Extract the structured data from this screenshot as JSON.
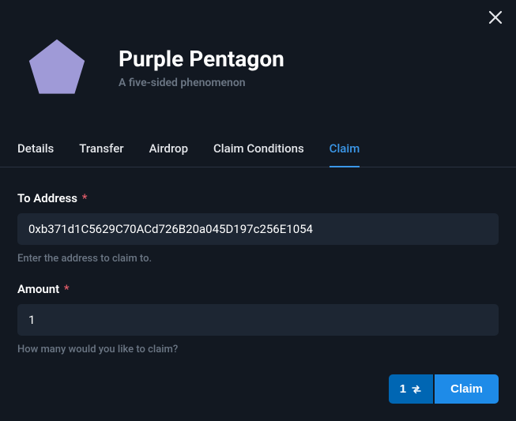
{
  "header": {
    "title": "Purple Pentagon",
    "subtitle": "A five-sided phenomenon",
    "pentagon_fill": "#9f9ad7"
  },
  "tabs": {
    "items": [
      "Details",
      "Transfer",
      "Airdrop",
      "Claim Conditions",
      "Claim"
    ],
    "active_index": 4
  },
  "form": {
    "to_address": {
      "label": "To Address",
      "required_marker": "*",
      "value": "0xb371d1C5629C70ACd726B20a045D197c256E1054",
      "help": "Enter the address to claim to."
    },
    "amount": {
      "label": "Amount",
      "required_marker": "*",
      "value": "1",
      "help": "How many would you like to claim?"
    }
  },
  "footer": {
    "count": "1",
    "claim_label": "Claim"
  }
}
